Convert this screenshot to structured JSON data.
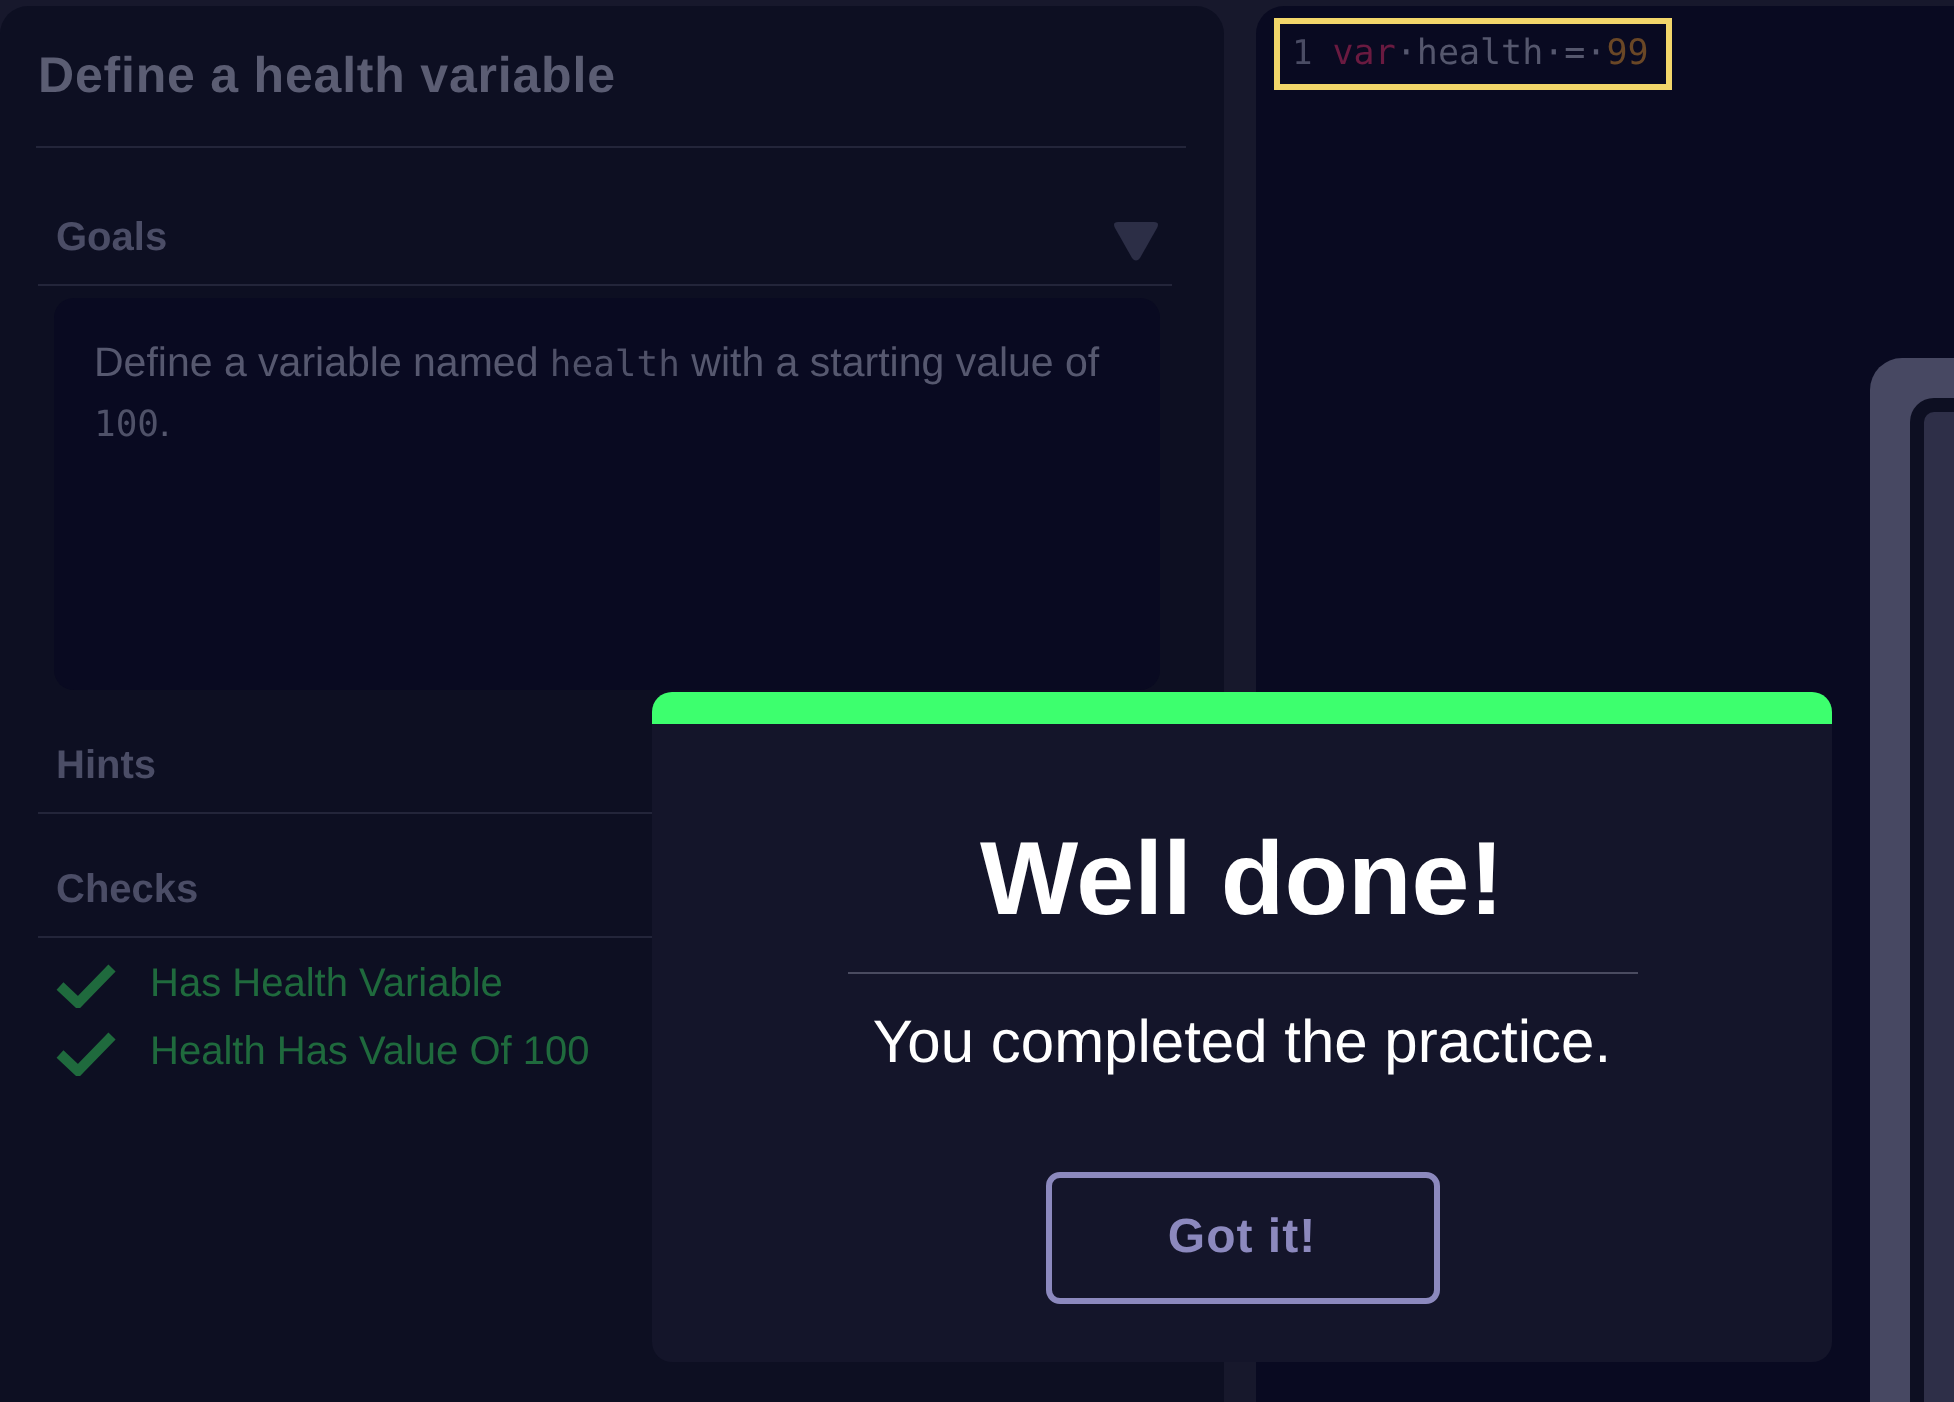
{
  "lesson": {
    "title": "Define a health variable"
  },
  "sections": [
    {
      "kind": "goals",
      "title": "Goals",
      "expanded": true,
      "body": [
        {
          "kind": "text",
          "text": "Define a variable named "
        },
        {
          "kind": "code",
          "text": "health"
        },
        {
          "kind": "text",
          "text": " with a starting value of "
        },
        {
          "kind": "code",
          "text": "100"
        },
        {
          "kind": "text",
          "text": "."
        }
      ]
    },
    {
      "kind": "hints",
      "title": "Hints"
    },
    {
      "kind": "checks",
      "title": "Checks",
      "checks": [
        {
          "label": "Has Health Variable",
          "passed": true
        },
        {
          "label": "Health Has Value Of 100",
          "passed": true
        }
      ]
    }
  ],
  "editor": {
    "lines": [
      {
        "number": "1",
        "highlighted": true,
        "tokens": [
          {
            "kind": "keyword",
            "text": "var"
          },
          {
            "kind": "whitespace",
            "text": "·"
          },
          {
            "kind": "identifier",
            "text": "health"
          },
          {
            "kind": "whitespace",
            "text": "·"
          },
          {
            "kind": "operator",
            "text": "="
          },
          {
            "kind": "whitespace",
            "text": "·"
          },
          {
            "kind": "number",
            "text": "99"
          }
        ]
      }
    ]
  },
  "dialog": {
    "title": "Well done!",
    "message": "You completed the practice.",
    "button": "Got it!"
  }
}
